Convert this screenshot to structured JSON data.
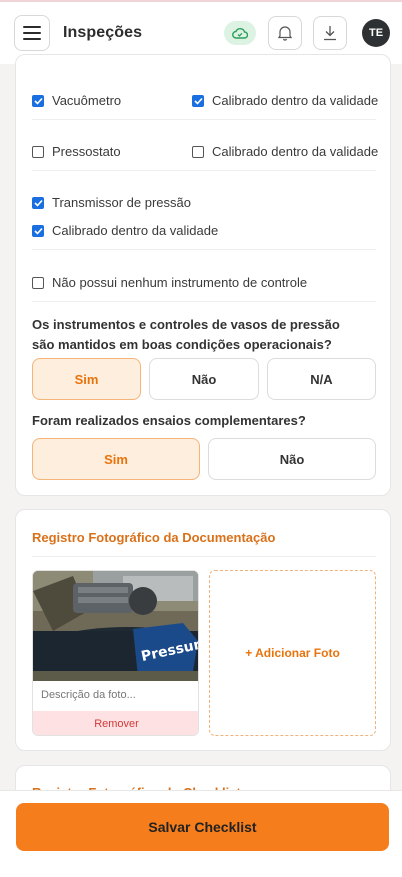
{
  "header": {
    "title": "Inspeções",
    "avatar_initials": "TE",
    "sync_color": "#2f9e5c"
  },
  "instruments": {
    "rows": [
      {
        "left": {
          "label": "Vacuômetro",
          "checked": true
        },
        "right": {
          "label": "Calibrado dentro da validade",
          "checked": true
        }
      },
      {
        "left": {
          "label": "Pressostato",
          "checked": false
        },
        "right": {
          "label": "Calibrado dentro da validade",
          "checked": false
        }
      }
    ],
    "transmissor": {
      "label": "Transmissor de pressão",
      "checked": true
    },
    "transmissor_calibrado": {
      "label": "Calibrado dentro da validade",
      "checked": true
    },
    "nenhum": {
      "label": "Não possui nenhum instrumento de controle",
      "checked": false
    }
  },
  "questions": [
    {
      "text": "Os instrumentos e controles de vasos de pressão são mantidos em boas condições operacionais?",
      "options": [
        "Sim",
        "Não",
        "N/A"
      ],
      "selected": "Sim"
    },
    {
      "text": "Foram realizados ensaios complementares?",
      "options": [
        "Sim",
        "Não"
      ],
      "selected": "Sim"
    }
  ],
  "photo_section": {
    "title": "Registro Fotográfico da Documentação",
    "photo_description_placeholder": "Descrição da foto...",
    "remove_label": "Remover",
    "add_label": "+ Adicionar Foto",
    "photo_brand_text": "Pressure"
  },
  "checklist_section": {
    "title": "Registro Fotográfico do Checklist"
  },
  "footer": {
    "save_label": "Salvar Checklist"
  },
  "colors": {
    "accent": "#f67d1b",
    "checkbox": "#1a6fe0",
    "selected_bg": "#fdeedd"
  }
}
